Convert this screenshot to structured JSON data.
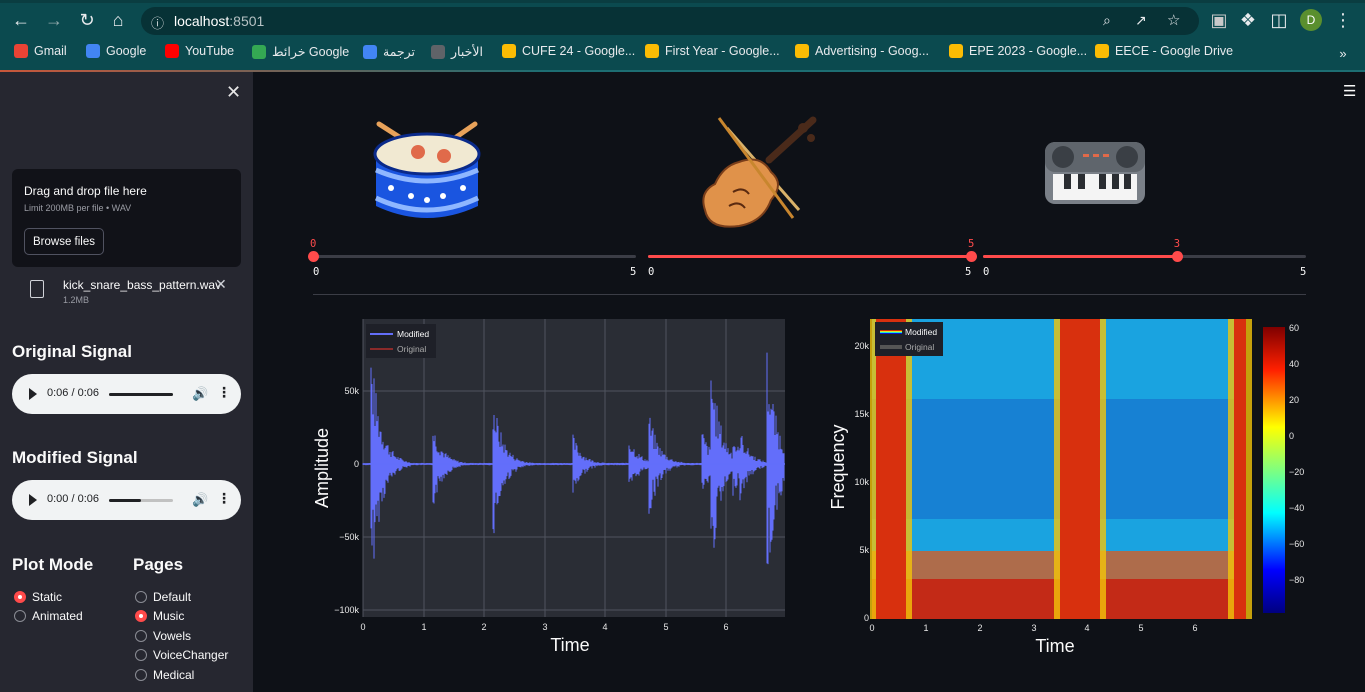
{
  "browser": {
    "url_host": "localhost",
    "url_port": ":8501",
    "profile_initial": "D",
    "bookmarks": [
      {
        "label": "Gmail",
        "color": "#ea4335"
      },
      {
        "label": "Google",
        "color": "#4285f4"
      },
      {
        "label": "YouTube",
        "color": "#ff0000"
      },
      {
        "label": "خرائط Google",
        "color": "#34a853"
      },
      {
        "label": "ترجمة",
        "color": "#4285f4"
      },
      {
        "label": "الأخبار",
        "color": "#5f6368"
      },
      {
        "label": "CUFE 24 - Google...",
        "color": "#fbbc04"
      },
      {
        "label": "First Year - Google...",
        "color": "#fbbc04"
      },
      {
        "label": "Advertising - Goog...",
        "color": "#fbbc04"
      },
      {
        "label": "EPE 2023 - Google...",
        "color": "#fbbc04"
      },
      {
        "label": "EECE - Google Drive",
        "color": "#fbbc04"
      }
    ]
  },
  "sidebar": {
    "uploader": {
      "title": "Drag and drop file here",
      "limit": "Limit 200MB per file • WAV",
      "browse_label": "Browse files"
    },
    "file": {
      "name": "kick_snare_bass_pattern.wav",
      "size": "1.2MB"
    },
    "original": {
      "title": "Original Signal",
      "time": "0:06 / 0:06",
      "progress": 1.0
    },
    "modified": {
      "title": "Modified Signal",
      "time": "0:00 / 0:06",
      "progress": 0.5
    },
    "plot_mode": {
      "title": "Plot Mode",
      "options": [
        "Static",
        "Animated"
      ],
      "selected": 0
    },
    "pages": {
      "title": "Pages",
      "options": [
        "Default",
        "Music",
        "Vowels",
        "VoiceChanger",
        "Medical"
      ],
      "selected": 1
    }
  },
  "sliders": [
    {
      "name": "drum",
      "value": "0",
      "min": "0",
      "max": "5",
      "fraction": 0.0
    },
    {
      "name": "violin",
      "value": "5",
      "min": "0",
      "max": "5",
      "fraction": 1.0
    },
    {
      "name": "piano",
      "value": "3",
      "min": "0",
      "max": "5",
      "fraction": 0.6
    }
  ],
  "plots": {
    "waveform": {
      "xlabel": "Time",
      "ylabel": "Amplitude",
      "legend": [
        "Modified",
        "Original"
      ],
      "xticks": [
        "0",
        "1",
        "2",
        "3",
        "4",
        "5",
        "6"
      ],
      "yticks": [
        "50k",
        "0",
        "−50k",
        "−100k"
      ]
    },
    "spectrogram": {
      "xlabel": "Time",
      "ylabel": "Frequency",
      "legend": [
        "Modified",
        "Original"
      ],
      "xticks": [
        "0",
        "1",
        "2",
        "3",
        "4",
        "5",
        "6"
      ],
      "yticks": [
        "20k",
        "15k",
        "10k",
        "5k",
        "0"
      ],
      "colorbar": [
        "60",
        "40",
        "20",
        "0",
        "−20",
        "−40",
        "−60",
        "−80"
      ]
    }
  },
  "colors": {
    "accent": "#ff4b4b",
    "wave": "#636efa",
    "bg": "#0e1117",
    "sidebar": "#262730"
  }
}
